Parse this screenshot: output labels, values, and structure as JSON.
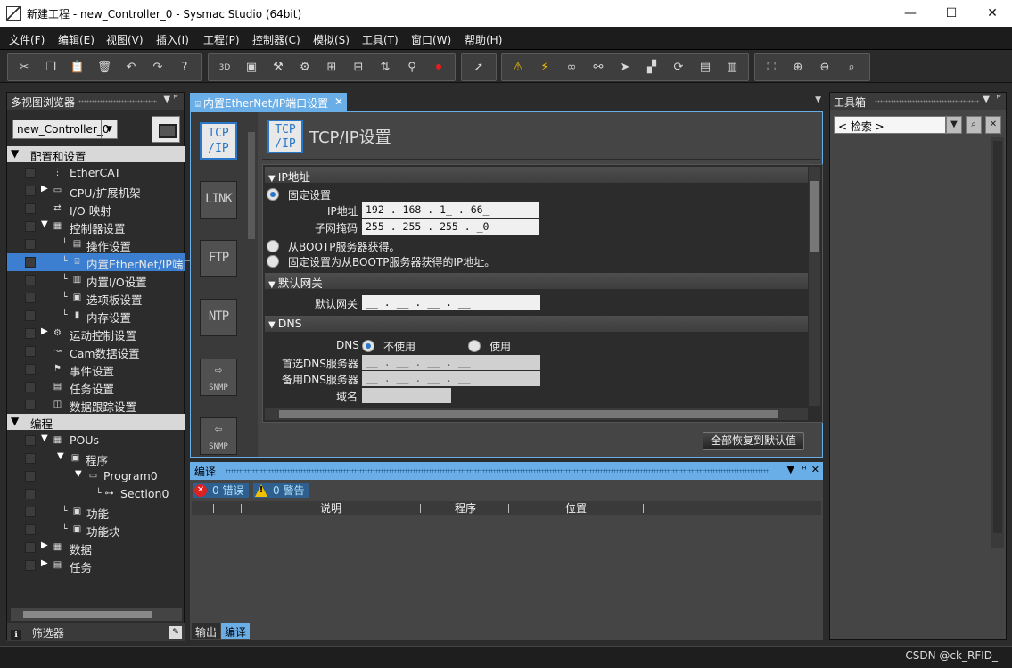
{
  "window": {
    "title": "新建工程 - new_Controller_0 - Sysmac Studio (64bit)",
    "minimize": "—",
    "maximize": "☐",
    "close": "✕"
  },
  "menu": [
    "文件(F)",
    "编辑(E)",
    "视图(V)",
    "插入(I)",
    "工程(P)",
    "控制器(C)",
    "模拟(S)",
    "工具(T)",
    "窗口(W)",
    "帮助(H)"
  ],
  "left_panel": {
    "title": "多视图浏览器",
    "pin": "▼  ꟸ",
    "controller": "new_Controller_0",
    "filter": "筛选器",
    "filter_icon": "ℹ",
    "edit_icon": "✎",
    "tree": [
      {
        "label": "配置和设置",
        "section": true
      },
      {
        "label": "EtherCAT"
      },
      {
        "label": "CPU/扩展机架"
      },
      {
        "label": "I/O 映射"
      },
      {
        "label": "控制器设置"
      },
      {
        "label": "操作设置"
      },
      {
        "label": "内置EtherNet/IP端口设置",
        "selected": true
      },
      {
        "label": "内置I/O设置"
      },
      {
        "label": "选项板设置"
      },
      {
        "label": "内存设置"
      },
      {
        "label": "运动控制设置"
      },
      {
        "label": "Cam数据设置"
      },
      {
        "label": "事件设置"
      },
      {
        "label": "任务设置"
      },
      {
        "label": "数据跟踪设置"
      },
      {
        "label": "编程",
        "section": true
      },
      {
        "label": "POUs"
      },
      {
        "label": "程序"
      },
      {
        "label": "Program0"
      },
      {
        "label": "Section0"
      },
      {
        "label": "功能"
      },
      {
        "label": "功能块"
      },
      {
        "label": "数据"
      },
      {
        "label": "任务"
      }
    ]
  },
  "editor": {
    "tab_title": "内置EtherNet/IP端口设置",
    "tab_close": "✕",
    "side_buttons": [
      {
        "l1": "TCP",
        "l2": "/IP"
      },
      {
        "label": "LINK"
      },
      {
        "label": "FTP"
      },
      {
        "label": "NTP"
      },
      {
        "label": "SNMP",
        "arrow": "⇨"
      },
      {
        "label": "SNMP",
        "arrow": "⇦"
      }
    ],
    "header_title": "TCP/IP设置",
    "sections": {
      "ip": "IP地址",
      "gateway": "默认网关",
      "dns": "DNS"
    },
    "ip": {
      "fixed": "固定设置",
      "ip_label": "IP地址",
      "ip_value": "192 . 168 . 1_ . 66_",
      "mask_label": "子网掩码",
      "mask_value": "255 . 255 . 255 . _0",
      "bootp": "从BOOTP服务器获得。",
      "bootp_fixed": "固定设置为从BOOTP服务器获得的IP地址。"
    },
    "gateway": {
      "label": "默认网关",
      "value": "__ . __ . __ . __"
    },
    "dns": {
      "label": "DNS",
      "not_use": "不使用",
      "use": "使用",
      "primary_label": "首选DNS服务器",
      "primary_value": "__ . __ . __ . __",
      "secondary_label": "备用DNS服务器",
      "secondary_value": "__ . __ . __ . __",
      "domain_label": "域名",
      "domain_value": ""
    },
    "restore_button": "全部恢复到默认值"
  },
  "compile_panel": {
    "title": "编译",
    "errors": "0  错误",
    "warnings": "0  警告",
    "columns": [
      "说明",
      "程序",
      "位置"
    ],
    "tabs": [
      "输出",
      "编译"
    ]
  },
  "right_panel": {
    "title": "工具箱",
    "search": "< 检索 >"
  },
  "status_bar": {
    "watermark": "CSDN @ck_RFID_"
  }
}
